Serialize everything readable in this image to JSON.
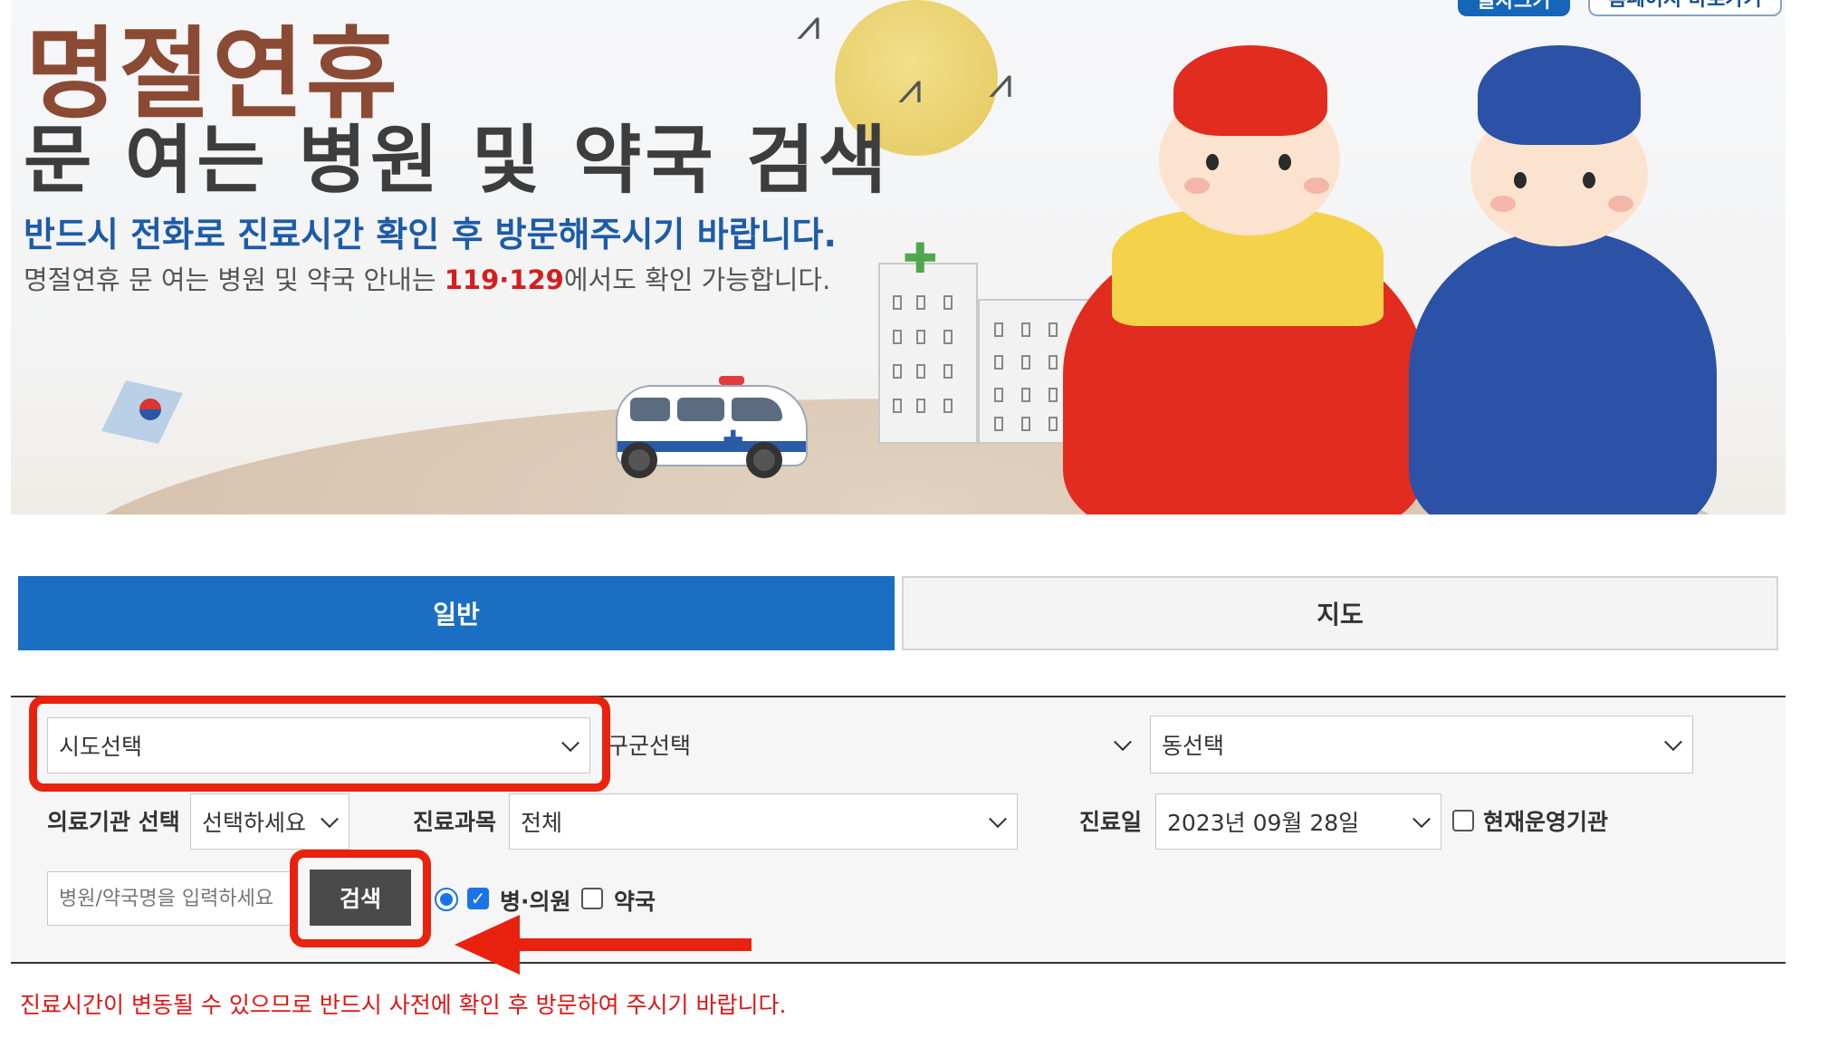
{
  "banner": {
    "top_button_left": "글자크기",
    "top_button_right": "홈페이지 바로가기",
    "title_line1": "명절연휴",
    "title_line2": "문 여는 병원 및 약국 검색",
    "notice_line1": "반드시 전화로 진료시간 확인 후 방문해주시기 바랍니다.",
    "notice_line2_prefix": "명절연휴 문 여는 병원 및 약국 안내는 ",
    "notice_line2_highlight": "119·129",
    "notice_line2_suffix": "에서도 확인 가능합니다."
  },
  "tabs": [
    {
      "label": "일반",
      "active": true
    },
    {
      "label": "지도",
      "active": false
    }
  ],
  "search": {
    "sido_select": "시도선택",
    "gugun_select": "구군선택",
    "dong_select": "동선택",
    "institution_label": "의료기관 선택",
    "institution_select": "선택하세요",
    "department_label": "진료과목",
    "department_select": "전체",
    "date_label": "진료일",
    "date_select": "2023년 09월 28일",
    "open_now_label": "현재운영기관",
    "open_now_checked": false,
    "name_placeholder": "병원/약국명을 입력하세요",
    "search_button": "검색",
    "hospital_label": "병·의원",
    "hospital_checked": true,
    "pharmacy_label": "약국",
    "pharmacy_checked": false
  },
  "footer_notice": "진료시간이 변동될 수 있으므로 반드시 사전에 확인 후 방문하여 주시기 바랍니다.",
  "colors": {
    "tab_active": "#1a6fc3",
    "title_brown": "#8b4a34",
    "notice_blue": "#1c5ba8",
    "highlight_red": "#e8220f",
    "search_button": "#4a4a4a"
  }
}
